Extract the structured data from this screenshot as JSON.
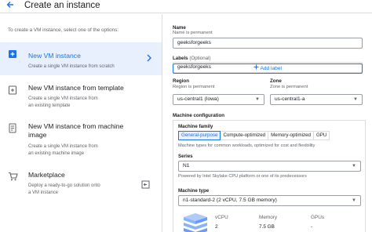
{
  "header": {
    "title": "Create an instance"
  },
  "left": {
    "intro": "To create a VM instance, select one of the options:",
    "options": [
      {
        "title": "New VM instance",
        "desc": [
          "Create a single VM instance from scratch"
        ]
      },
      {
        "title": "New VM instance from template",
        "desc": [
          "Create a single VM instance from",
          "an existing template"
        ]
      },
      {
        "title": [
          "New VM instance from machine",
          "image"
        ],
        "desc": [
          "Create a single VM instance from",
          "an existing machine image"
        ]
      },
      {
        "title": "Marketplace",
        "desc": [
          "Deploy a ready-to-go solution onto",
          "a VM instance"
        ]
      }
    ]
  },
  "form": {
    "name_label": "Name",
    "name_hint": "Name is permanent",
    "name_value": "geeksforgeeks",
    "labels_label": "Labels",
    "labels_optional": "(Optional)",
    "labels_chip": "geeksforgeeks",
    "add_label": "Add label",
    "region_label": "Region",
    "region_hint": "Region is permanent",
    "region_value": "us-central1 (Iowa)",
    "zone_label": "Zone",
    "zone_hint": "Zone is permanent",
    "zone_value": "us-central1-a",
    "machine_config_label": "Machine configuration",
    "machine_family_label": "Machine family",
    "family_tabs": [
      "General-purpose",
      "Compute-optimized",
      "Memory-optimized",
      "GPU"
    ],
    "family_desc": "Machine types for common workloads, optimized for cost and flexibility",
    "series_label": "Series",
    "series_value": "N1",
    "series_desc": "Powered by Intel Skylake CPU platform or one of its predecessors",
    "machine_type_label": "Machine type",
    "machine_type_value": "n1-standard-2 (2 vCPU, 7.5 GB memory)",
    "cols": {
      "vcpu": "vCPU",
      "memory": "Memory",
      "gpus": "GPUs"
    },
    "vals": {
      "vcpu": "2",
      "memory": "7.5 GB",
      "gpus": "-"
    }
  },
  "colors": {
    "accent": "#1a73e8",
    "selected_bg": "#e8f0fe",
    "border": "#dadce0"
  },
  "icons": [
    "back-arrow-icon",
    "add-box-icon",
    "template-icon",
    "machine-image-icon",
    "cart-icon",
    "chevron-right-icon",
    "launch-icon",
    "plus-icon",
    "dropdown-arrow-icon",
    "server-icon"
  ]
}
